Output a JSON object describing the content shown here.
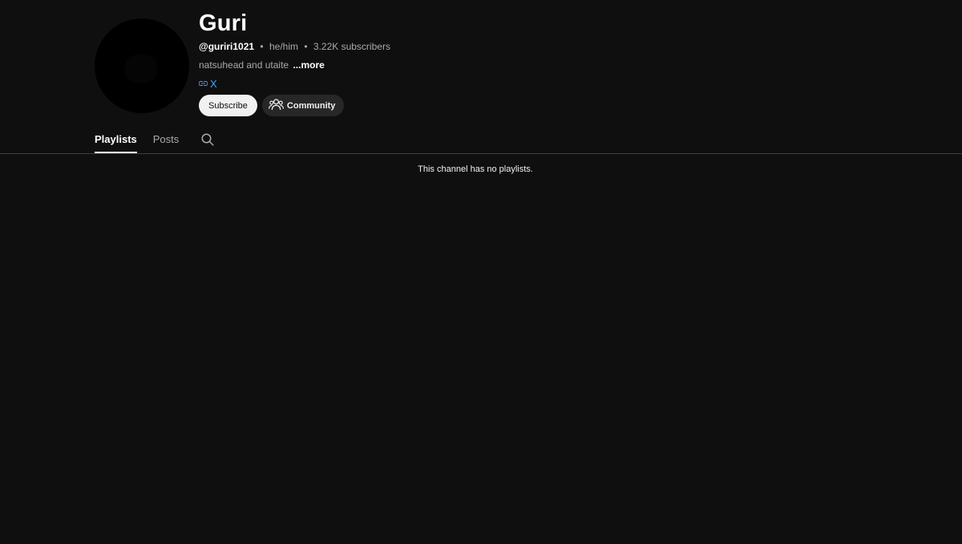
{
  "channel": {
    "title": "Guri",
    "handle": "@guriri1021",
    "pronouns": "he/him",
    "subscribers": "3.22K subscribers",
    "meta_separator": "•",
    "description": "natsuhead and utaite",
    "more_label": "...more",
    "link_icon": "link-icon",
    "link_label": "X"
  },
  "actions": {
    "subscribe_label": "Subscribe",
    "community_label": "Community",
    "community_icon": "people-icon"
  },
  "tabs": [
    {
      "label": "Playlists",
      "active": true
    },
    {
      "label": "Posts",
      "active": false
    }
  ],
  "tabs_search_icon": "search-icon",
  "content": {
    "empty_message": "This channel has no playlists."
  },
  "colors": {
    "background": "#0f0f0f",
    "link": "#3ea6ff",
    "subscribe_bg": "#f1f1f1",
    "community_bg": "#272727"
  }
}
